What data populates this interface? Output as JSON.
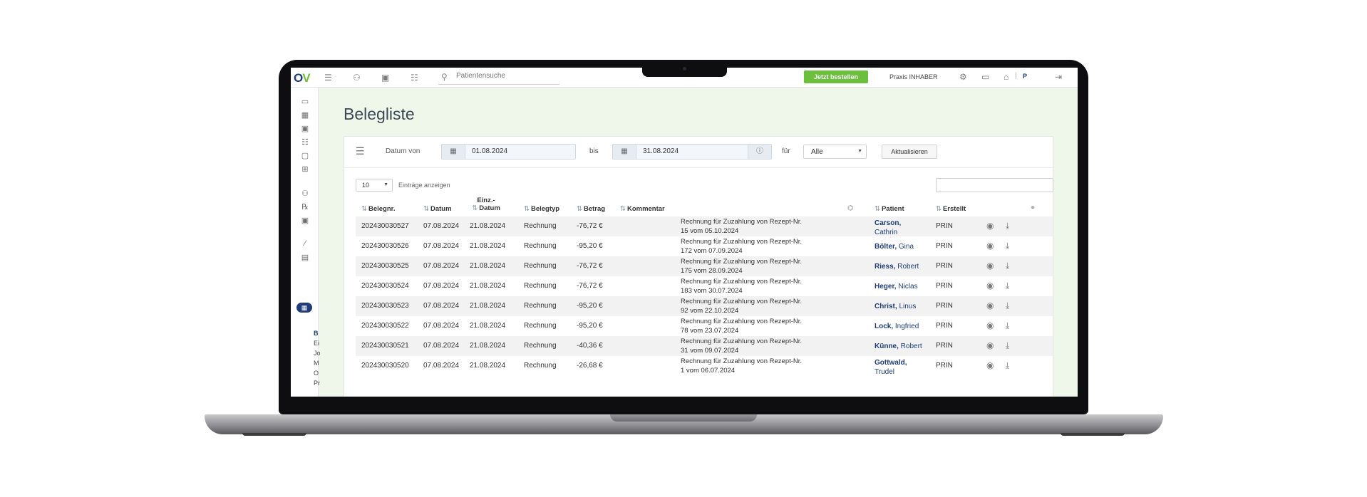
{
  "app": {
    "logo_o": "O",
    "logo_v": "V"
  },
  "topbar": {
    "search_placeholder": "Patientensuche",
    "order_button": "Jetzt bestellen",
    "practice_name": "Praxis INHABER",
    "separator": "|",
    "user_initial": "P"
  },
  "sidebar": {
    "submenu": [
      "B",
      "Ei",
      "Jo",
      "M",
      "O",
      "Pr"
    ]
  },
  "page": {
    "title": "Belegliste"
  },
  "filter": {
    "date_from_label": "Datum von",
    "date_from": "01.08.2024",
    "to_label": "bis",
    "date_to": "31.08.2024",
    "for_label": "für",
    "for_value": "Alle",
    "update_button": "Aktualisieren"
  },
  "entries": {
    "value": "10",
    "label": "Einträge anzeigen"
  },
  "table": {
    "headers": {
      "belegnr": "Belegnr.",
      "datum": "Datum",
      "einz_line1": "Einz.-",
      "einz_line2": "Datum",
      "belegtyp": "Belegtyp",
      "betrag": "Betrag",
      "kommentar": "Kommentar",
      "patient": "Patient",
      "erstellt": "Erstellt"
    },
    "rows": [
      {
        "belegnr": "202430030527",
        "datum": "07.08.2024",
        "einz": "21.08.2024",
        "typ": "Rechnung",
        "betrag": "-76,72 €",
        "k1": "Rechnung für Zuzahlung von Rezept-Nr.",
        "k2": "15 vom 05.10.2024",
        "last": "Carson,",
        "first": "Cathrin",
        "erstellt": "PRIN"
      },
      {
        "belegnr": "202430030526",
        "datum": "07.08.2024",
        "einz": "21.08.2024",
        "typ": "Rechnung",
        "betrag": "-95,20 €",
        "k1": "Rechnung für Zuzahlung von Rezept-Nr.",
        "k2": "172 vom 07.09.2024",
        "last": "Bölter,",
        "first": "Gina",
        "erstellt": "PRIN"
      },
      {
        "belegnr": "202430030525",
        "datum": "07.08.2024",
        "einz": "21.08.2024",
        "typ": "Rechnung",
        "betrag": "-76,72 €",
        "k1": "Rechnung für Zuzahlung von Rezept-Nr.",
        "k2": "175 vom 28.09.2024",
        "last": "Riess,",
        "first": "Robert",
        "erstellt": "PRIN"
      },
      {
        "belegnr": "202430030524",
        "datum": "07.08.2024",
        "einz": "21.08.2024",
        "typ": "Rechnung",
        "betrag": "-76,72 €",
        "k1": "Rechnung für Zuzahlung von Rezept-Nr.",
        "k2": "183 vom 30.07.2024",
        "last": "Heger,",
        "first": "Niclas",
        "erstellt": "PRIN"
      },
      {
        "belegnr": "202430030523",
        "datum": "07.08.2024",
        "einz": "21.08.2024",
        "typ": "Rechnung",
        "betrag": "-95,20 €",
        "k1": "Rechnung für Zuzahlung von Rezept-Nr.",
        "k2": "92 vom 22.10.2024",
        "last": "Christ,",
        "first": "Linus",
        "erstellt": "PRIN"
      },
      {
        "belegnr": "202430030522",
        "datum": "07.08.2024",
        "einz": "21.08.2024",
        "typ": "Rechnung",
        "betrag": "-95,20 €",
        "k1": "Rechnung für Zuzahlung von Rezept-Nr.",
        "k2": "78 vom 23.07.2024",
        "last": "Lock,",
        "first": "Ingfried",
        "erstellt": "PRIN"
      },
      {
        "belegnr": "202430030521",
        "datum": "07.08.2024",
        "einz": "21.08.2024",
        "typ": "Rechnung",
        "betrag": "-40,36 €",
        "k1": "Rechnung für Zuzahlung von Rezept-Nr.",
        "k2": "31 vom 09.07.2024",
        "last": "Künne,",
        "first": "Robert",
        "erstellt": "PRIN"
      },
      {
        "belegnr": "202430030520",
        "datum": "07.08.2024",
        "einz": "21.08.2024",
        "typ": "Rechnung",
        "betrag": "-26,68 €",
        "k1": "Rechnung für Zuzahlung von Rezept-Nr.",
        "k2": "1 vom 06.07.2024",
        "last": "Gottwald,",
        "first": "Trudel",
        "erstellt": "PRIN"
      }
    ]
  },
  "icons": {
    "menu": "☰",
    "user": "⚇",
    "document": "▣",
    "list": "☷",
    "search": "⚲",
    "settings": "⚙",
    "inbox": "▭",
    "home": "⌂",
    "logout": "⇥",
    "filter": "☰",
    "calendar": "▦",
    "info": "ⓘ",
    "caret": "▼",
    "sort": "⇅",
    "tag": "⌬",
    "link": "⚭",
    "view": "◉",
    "download": "⤓"
  }
}
